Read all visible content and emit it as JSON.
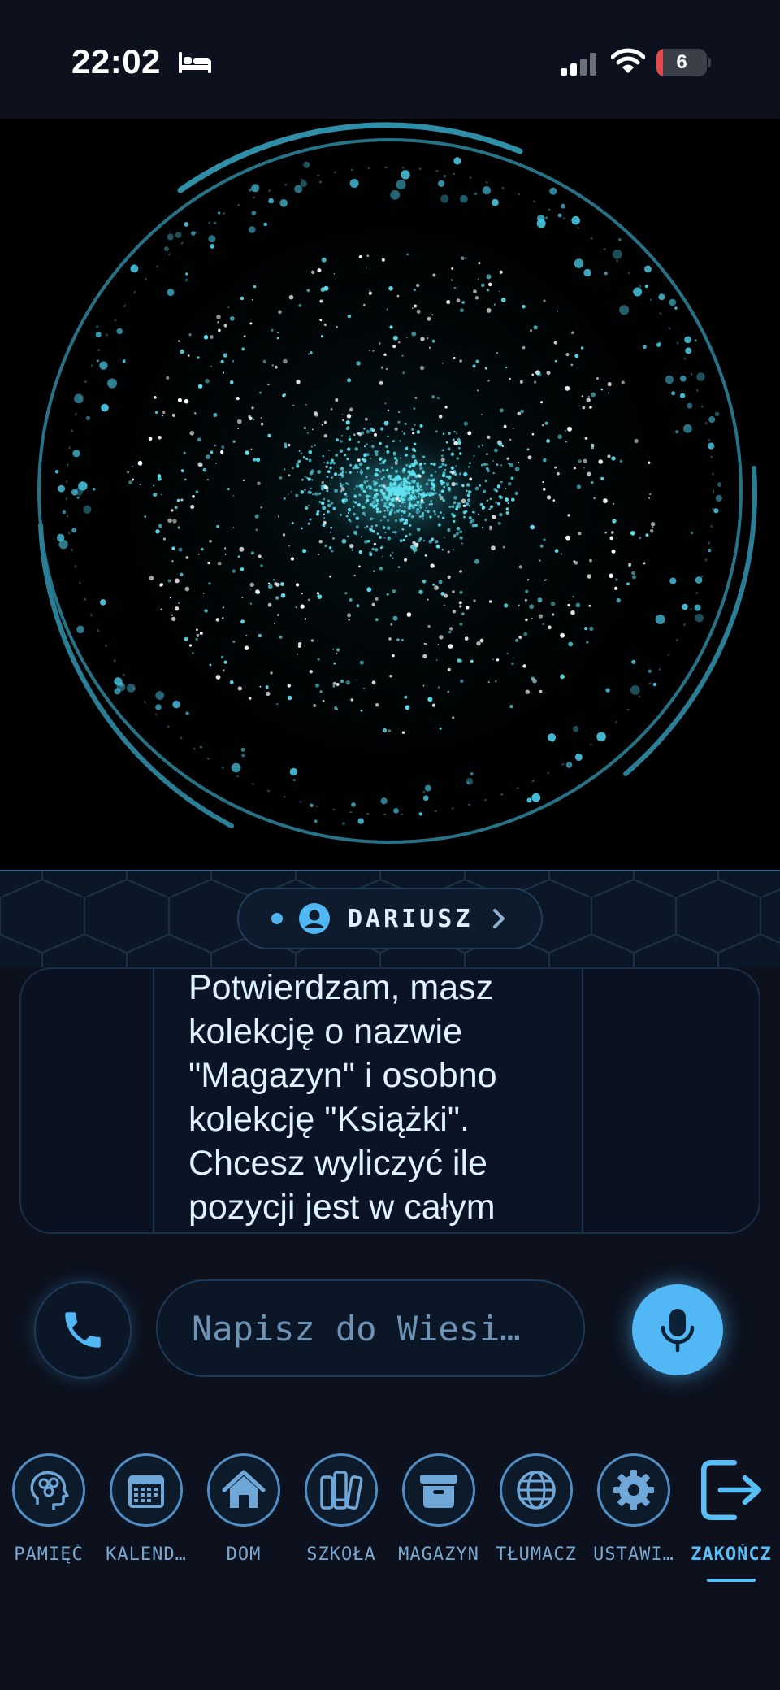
{
  "status_bar": {
    "time": "22:02",
    "battery_level": "6",
    "icons": [
      "bed-icon",
      "signal-icon",
      "wifi-icon",
      "battery-icon"
    ]
  },
  "assistant": {
    "user_name": "DARIUSZ",
    "message": "Potwierdzam, masz kolekcję o nazwie \"Magazyn\" i osobno kolekcję \"Książki\". Chcesz wyliczyć ile pozycji jest w całym magazynie?"
  },
  "composer": {
    "placeholder": "Napisz do Wiesi…"
  },
  "nav": {
    "items": [
      {
        "label": "PAMIĘĆ",
        "icon": "brain-icon"
      },
      {
        "label": "KALEND…",
        "icon": "calendar-icon"
      },
      {
        "label": "DOM",
        "icon": "home-icon"
      },
      {
        "label": "SZKOŁA",
        "icon": "books-icon"
      },
      {
        "label": "MAGAZYN",
        "icon": "archive-box-icon"
      },
      {
        "label": "TŁUMACZ",
        "icon": "globe-icon"
      },
      {
        "label": "USTAWI…",
        "icon": "gear-icon"
      },
      {
        "label": "ZAKOŃCZ",
        "icon": "exit-icon"
      }
    ],
    "active": "ZAKOŃCZ"
  },
  "colors": {
    "accent": "#52b7f5",
    "background": "#0c111d",
    "particle": "#5fe3f0"
  }
}
